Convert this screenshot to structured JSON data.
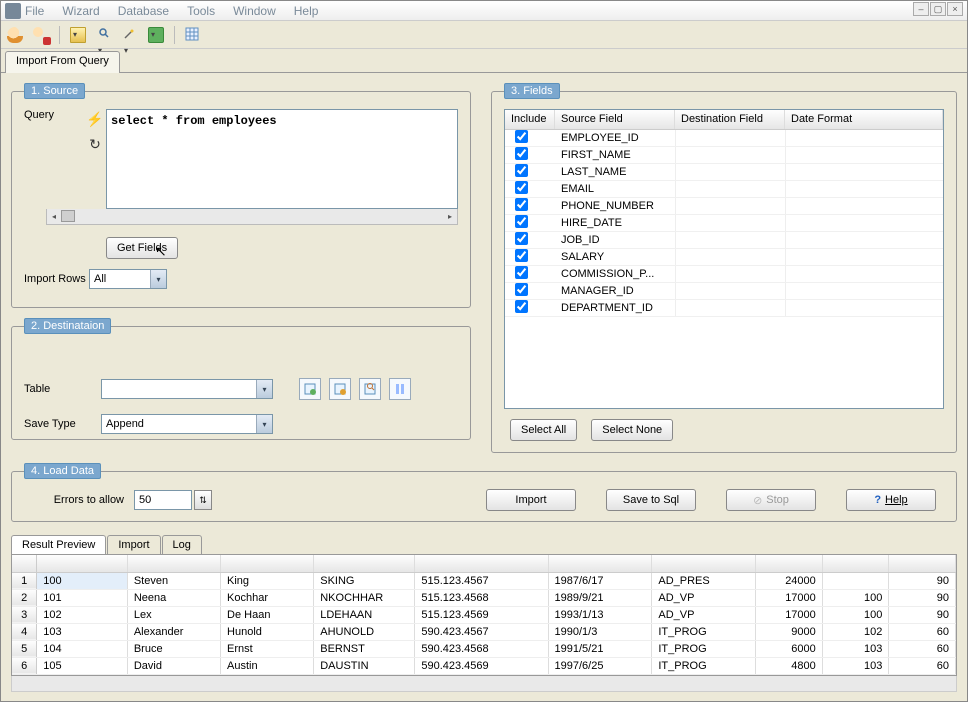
{
  "menubar": [
    "File",
    "Wizard",
    "Database",
    "Tools",
    "Window",
    "Help"
  ],
  "tab_main": "Import From Query",
  "source": {
    "legend": "1. Source",
    "query_label": "Query",
    "query_text": "select * from employees",
    "get_fields": "Get Fields",
    "import_rows_label": "Import Rows",
    "import_rows_value": "All"
  },
  "destination": {
    "legend": "2. Destinataion",
    "table_label": "Table",
    "table_value": "",
    "savetype_label": "Save Type",
    "savetype_value": "Append"
  },
  "fields": {
    "legend": "3. Fields",
    "headers": [
      "Include",
      "Source Field",
      "Destination Field",
      "Date Format"
    ],
    "rows": [
      {
        "inc": true,
        "src": "EMPLOYEE_ID"
      },
      {
        "inc": true,
        "src": "FIRST_NAME"
      },
      {
        "inc": true,
        "src": "LAST_NAME"
      },
      {
        "inc": true,
        "src": "EMAIL"
      },
      {
        "inc": true,
        "src": "PHONE_NUMBER"
      },
      {
        "inc": true,
        "src": "HIRE_DATE"
      },
      {
        "inc": true,
        "src": "JOB_ID"
      },
      {
        "inc": true,
        "src": "SALARY"
      },
      {
        "inc": true,
        "src": "COMMISSION_P..."
      },
      {
        "inc": true,
        "src": "MANAGER_ID"
      },
      {
        "inc": true,
        "src": "DEPARTMENT_ID"
      }
    ],
    "select_all": "Select All",
    "select_none": "Select None"
  },
  "load": {
    "legend": "4. Load Data",
    "errors_label": "Errors to allow",
    "errors_value": "50",
    "import": "Import",
    "save_sql": "Save to Sql",
    "stop": "Stop",
    "help": "Help"
  },
  "bottom_tabs": [
    "Result Preview",
    "Import",
    "Log"
  ],
  "grid": {
    "rows": [
      [
        "100",
        "Steven",
        "King",
        "SKING",
        "515.123.4567",
        "1987/6/17",
        "AD_PRES",
        "24000",
        "",
        "90"
      ],
      [
        "101",
        "Neena",
        "Kochhar",
        "NKOCHHAR",
        "515.123.4568",
        "1989/9/21",
        "AD_VP",
        "17000",
        "100",
        "90"
      ],
      [
        "102",
        "Lex",
        "De Haan",
        "LDEHAAN",
        "515.123.4569",
        "1993/1/13",
        "AD_VP",
        "17000",
        "100",
        "90"
      ],
      [
        "103",
        "Alexander",
        "Hunold",
        "AHUNOLD",
        "590.423.4567",
        "1990/1/3",
        "IT_PROG",
        "9000",
        "102",
        "60"
      ],
      [
        "104",
        "Bruce",
        "Ernst",
        "BERNST",
        "590.423.4568",
        "1991/5/21",
        "IT_PROG",
        "6000",
        "103",
        "60"
      ],
      [
        "105",
        "David",
        "Austin",
        "DAUSTIN",
        "590.423.4569",
        "1997/6/25",
        "IT_PROG",
        "4800",
        "103",
        "60"
      ]
    ]
  }
}
